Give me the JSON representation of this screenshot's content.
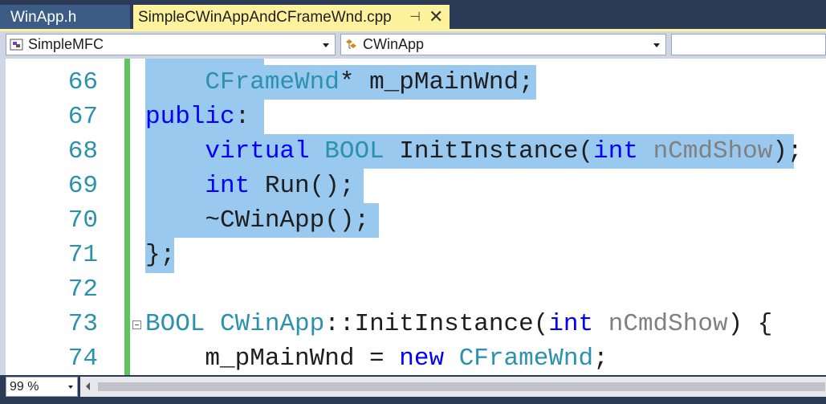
{
  "tabs": [
    {
      "label": "WinApp.h",
      "active": false
    },
    {
      "label": "SimpleCWinAppAndCFrameWnd.cpp",
      "active": true
    }
  ],
  "tab_icons": {
    "pin": "⊣",
    "close": "✕"
  },
  "navbar": {
    "project": "SimpleMFC",
    "scope": "CWinApp",
    "member": ""
  },
  "editor": {
    "lines": [
      {
        "num": "66"
      },
      {
        "num": "67"
      },
      {
        "num": "68"
      },
      {
        "num": "69"
      },
      {
        "num": "70"
      },
      {
        "num": "71"
      },
      {
        "num": "72"
      },
      {
        "num": "73"
      },
      {
        "num": "74"
      }
    ],
    "code": {
      "l66": {
        "type": "CFrameWnd",
        "rest": "* m_pMainWnd;"
      },
      "l67": {
        "kw": "public",
        "rest": ":"
      },
      "l68": {
        "kw1": "virtual",
        "type": "BOOL",
        "fn": "InitInstance(",
        "kw2": "int",
        "param": "nCmdShow",
        "end": ");"
      },
      "l69": {
        "kw": "int",
        "rest": "Run();"
      },
      "l70": {
        "rest": "~CWinApp();"
      },
      "l71": {
        "rest": "};"
      },
      "l73": {
        "type1": "BOOL",
        "type2": "CWinApp",
        "fn": "::InitInstance(",
        "kw": "int",
        "param": "nCmdShow",
        "end": ") {"
      },
      "l74": {
        "pre": "m_pMainWnd = ",
        "kw": "new",
        "type": "CFrameWnd",
        "end": ";"
      }
    }
  },
  "zoom": "99 %",
  "colors": {
    "keyword": "#0000ff",
    "type": "#2b91af",
    "parameter": "#808080",
    "selection": "#99c9ef",
    "change_bar": "#5ec55e",
    "active_tab": "#fff29d"
  }
}
